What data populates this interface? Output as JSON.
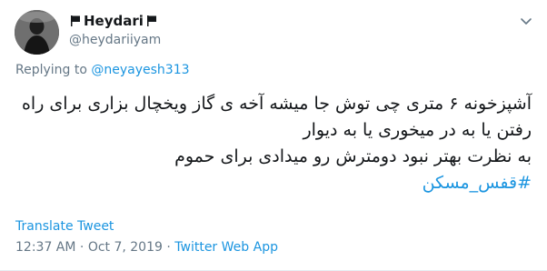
{
  "user": {
    "display_name": "Heydari",
    "handle": "@heydariiyam",
    "avatar_icon": "profile-photo",
    "flag_icon": "black-flag"
  },
  "reply": {
    "prefix": "Replying to",
    "mention": "@neyayesh313"
  },
  "tweet": {
    "lines": [
      "آشپزخونه ۶ متری چی توش جا میشه آخه ی گاز ویخچال بزاری برای راه",
      "رفتن یا به در میخوری یا به دیوار",
      "به نظرت بهتر نبود دومترش رو میدادی برای حموم"
    ],
    "hashtag": "#قفس_مسکن"
  },
  "actions": {
    "translate": "Translate Tweet",
    "caret_icon": "chevron-down-icon"
  },
  "meta": {
    "time": "12:37 AM",
    "separator1": " · ",
    "date": "Oct 7, 2019",
    "separator2": " · ",
    "source": "Twitter Web App"
  },
  "colors": {
    "link": "#1b95e0",
    "secondary_text": "#657786",
    "primary_text": "#14171a"
  }
}
